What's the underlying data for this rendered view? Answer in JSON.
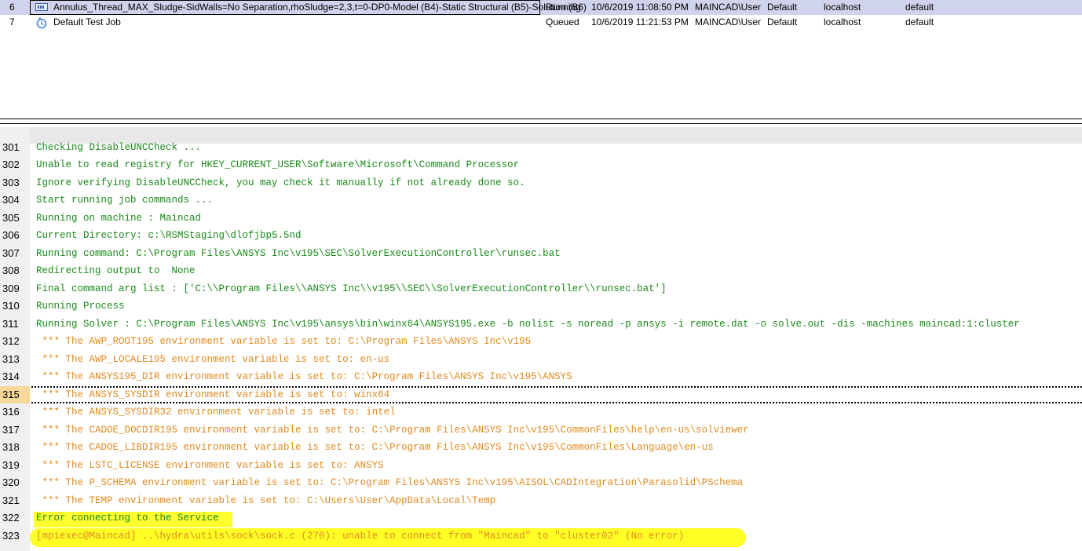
{
  "jobs": [
    {
      "num": "6",
      "name": "Annulus_Thread_MAX_Sludge-SidWalls=No Separation,rhoSludge=2,3,t=0-DP0-Model (B4)-Static Structural (B5)-Solution (B6)",
      "status": "Running",
      "submitted": "10/6/2019 11:08:50 PM",
      "owner": "MAINCAD\\User",
      "queue": "Default",
      "host": "localhost",
      "pool": "default",
      "icon": "running-job-icon"
    },
    {
      "num": "7",
      "name": "Default Test Job",
      "status": "Queued",
      "submitted": "10/6/2019 11:21:53 PM",
      "owner": "MAINCAD\\User",
      "queue": "Default",
      "host": "localhost",
      "pool": "default",
      "icon": "queued-job-icon"
    }
  ],
  "log_lines": [
    {
      "n": "301",
      "t": "Checking DisableUNCCheck ...",
      "c": "green"
    },
    {
      "n": "302",
      "t": "Unable to read registry for HKEY_CURRENT_USER\\Software\\Microsoft\\Command Processor",
      "c": "green"
    },
    {
      "n": "303",
      "t": "Ignore verifying DisableUNCCheck, you may check it manually if not already done so.",
      "c": "green"
    },
    {
      "n": "304",
      "t": "Start running job commands ...",
      "c": "green"
    },
    {
      "n": "305",
      "t": "Running on machine : Maincad",
      "c": "green"
    },
    {
      "n": "306",
      "t": "Current Directory: c:\\RSMStaging\\dlofjbp5.5nd",
      "c": "green"
    },
    {
      "n": "307",
      "t": "Running command: C:\\Program Files\\ANSYS Inc\\v195\\SEC\\SolverExecutionController\\runsec.bat",
      "c": "green"
    },
    {
      "n": "308",
      "t": "Redirecting output to  None",
      "c": "green"
    },
    {
      "n": "309",
      "t": "Final command arg list : ['C:\\\\Program Files\\\\ANSYS Inc\\\\v195\\\\SEC\\\\SolverExecutionController\\\\runsec.bat']",
      "c": "green"
    },
    {
      "n": "310",
      "t": "Running Process",
      "c": "green"
    },
    {
      "n": "311",
      "t": "Running Solver : C:\\Program Files\\ANSYS Inc\\v195\\ansys\\bin\\winx64\\ANSYS195.exe -b nolist -s noread -p ansys -i remote.dat -o solve.out -dis -machines maincad:1:cluster",
      "c": "green"
    },
    {
      "n": "312",
      "t": " *** The AWP_ROOT195 environment variable is set to: C:\\Program Files\\ANSYS Inc\\v195",
      "c": "orange"
    },
    {
      "n": "313",
      "t": " *** The AWP_LOCALE195 environment variable is set to: en-us",
      "c": "orange"
    },
    {
      "n": "314",
      "t": " *** The ANSYS195_DIR environment variable is set to: C:\\Program Files\\ANSYS Inc\\v195\\ANSYS",
      "c": "orange"
    },
    {
      "n": "315",
      "t": " *** The ANSYS_SYSDIR environment variable is set to: winx64",
      "c": "orange"
    },
    {
      "n": "316",
      "t": " *** The ANSYS_SYSDIR32 environment variable is set to: intel",
      "c": "orange"
    },
    {
      "n": "317",
      "t": " *** The CADOE_DOCDIR195 environment variable is set to: C:\\Program Files\\ANSYS Inc\\v195\\CommonFiles\\help\\en-us\\solviewer",
      "c": "orange"
    },
    {
      "n": "318",
      "t": " *** The CADOE_LIBDIR195 environment variable is set to: C:\\Program Files\\ANSYS Inc\\v195\\CommonFiles\\Language\\en-us",
      "c": "orange"
    },
    {
      "n": "319",
      "t": " *** The LSTC_LICENSE environment variable is set to: ANSYS",
      "c": "orange"
    },
    {
      "n": "320",
      "t": " *** The P_SCHEMA environment variable is set to: C:\\Program Files\\ANSYS Inc\\v195\\AISOL\\CADIntegration\\Parasolid\\PSchema",
      "c": "orange"
    },
    {
      "n": "321",
      "t": " *** The TEMP environment variable is set to: C:\\Users\\User\\AppData\\Local\\Temp",
      "c": "orange"
    },
    {
      "n": "322",
      "t": "Error connecting to the Service",
      "c": "green"
    },
    {
      "n": "323",
      "t": "[mpiexec@Maincad] ..\\hydra\\utils\\sock\\sock.c (270): unable to connect from \"Maincad\" to \"cluster02\" (No error)",
      "c": "orange"
    }
  ],
  "current_line": "315",
  "colors": {
    "info_text": "#1a8a1a",
    "env_text": "#e08a1e",
    "highlight": "#ffff00",
    "selected_row": "#cfd3ec"
  }
}
